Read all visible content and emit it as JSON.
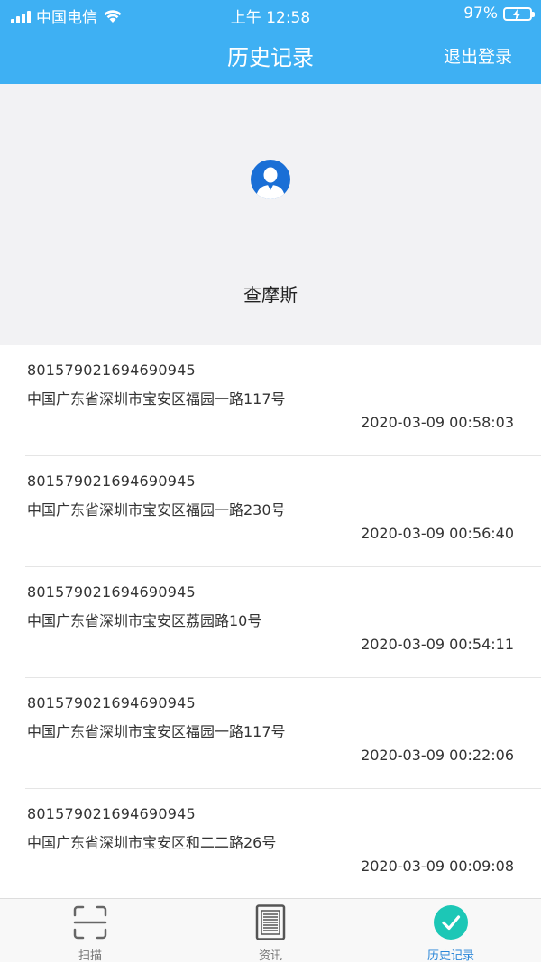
{
  "status_bar": {
    "carrier": "中国电信",
    "time": "上午 12:58",
    "battery": "97%",
    "signal_icon": "signal-bars-icon",
    "wifi_icon": "wifi-icon",
    "battery_icon": "battery-charging-icon"
  },
  "navbar": {
    "title": "历史记录",
    "logout_label": "退出登录"
  },
  "profile": {
    "avatar_icon": "user-avatar-icon",
    "name": "查摩斯"
  },
  "records": [
    {
      "code": "801579021694690945",
      "address": "中国广东省深圳市宝安区福园一路117号",
      "time": "2020-03-09 00:58:03"
    },
    {
      "code": "801579021694690945",
      "address": "中国广东省深圳市宝安区福园一路230号",
      "time": "2020-03-09 00:56:40"
    },
    {
      "code": "801579021694690945",
      "address": "中国广东省深圳市宝安区荔园路10号",
      "time": "2020-03-09 00:54:11"
    },
    {
      "code": "801579021694690945",
      "address": "中国广东省深圳市宝安区福园一路117号",
      "time": "2020-03-09 00:22:06"
    },
    {
      "code": "801579021694690945",
      "address": "中国广东省深圳市宝安区和二二路26号",
      "time": "2020-03-09 00:09:08"
    }
  ],
  "tabbar": {
    "tabs": [
      {
        "label": "扫描",
        "icon": "scan-icon"
      },
      {
        "label": "资讯",
        "icon": "document-icon"
      },
      {
        "label": "历史记录",
        "icon": "checkmark-circle-icon",
        "active": true
      }
    ]
  },
  "colors": {
    "primary": "#3eb0f3",
    "active_tab": "#2a86d8",
    "check_circle": "#1cc7b6"
  }
}
